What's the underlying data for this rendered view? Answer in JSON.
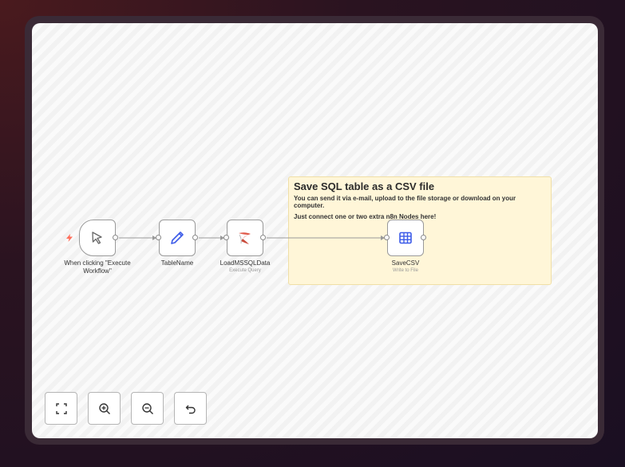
{
  "sticky": {
    "title": "Save SQL table as a CSV file",
    "line1": "You can send it via e-mail, upload to the file storage or download on your computer.",
    "line2": "Just connect one or two extra n8n Nodes here!"
  },
  "nodes": [
    {
      "name": "When clicking \"Execute Workflow\"",
      "subtitle": ""
    },
    {
      "name": "TableName",
      "subtitle": ""
    },
    {
      "name": "LoadMSSQLData",
      "subtitle": "Execute Query"
    },
    {
      "name": "SaveCSV",
      "subtitle": "Write to File"
    }
  ],
  "controls": [
    {
      "icon": "fit-view-icon"
    },
    {
      "icon": "zoom-in-icon"
    },
    {
      "icon": "zoom-out-icon"
    },
    {
      "icon": "reset-zoom-icon"
    }
  ],
  "colors": {
    "trigger_bolt": "#ff6d5a",
    "pencil": "#3d5ce8",
    "table": "#3d5ce8",
    "sticky_bg": "#fff6d8"
  }
}
